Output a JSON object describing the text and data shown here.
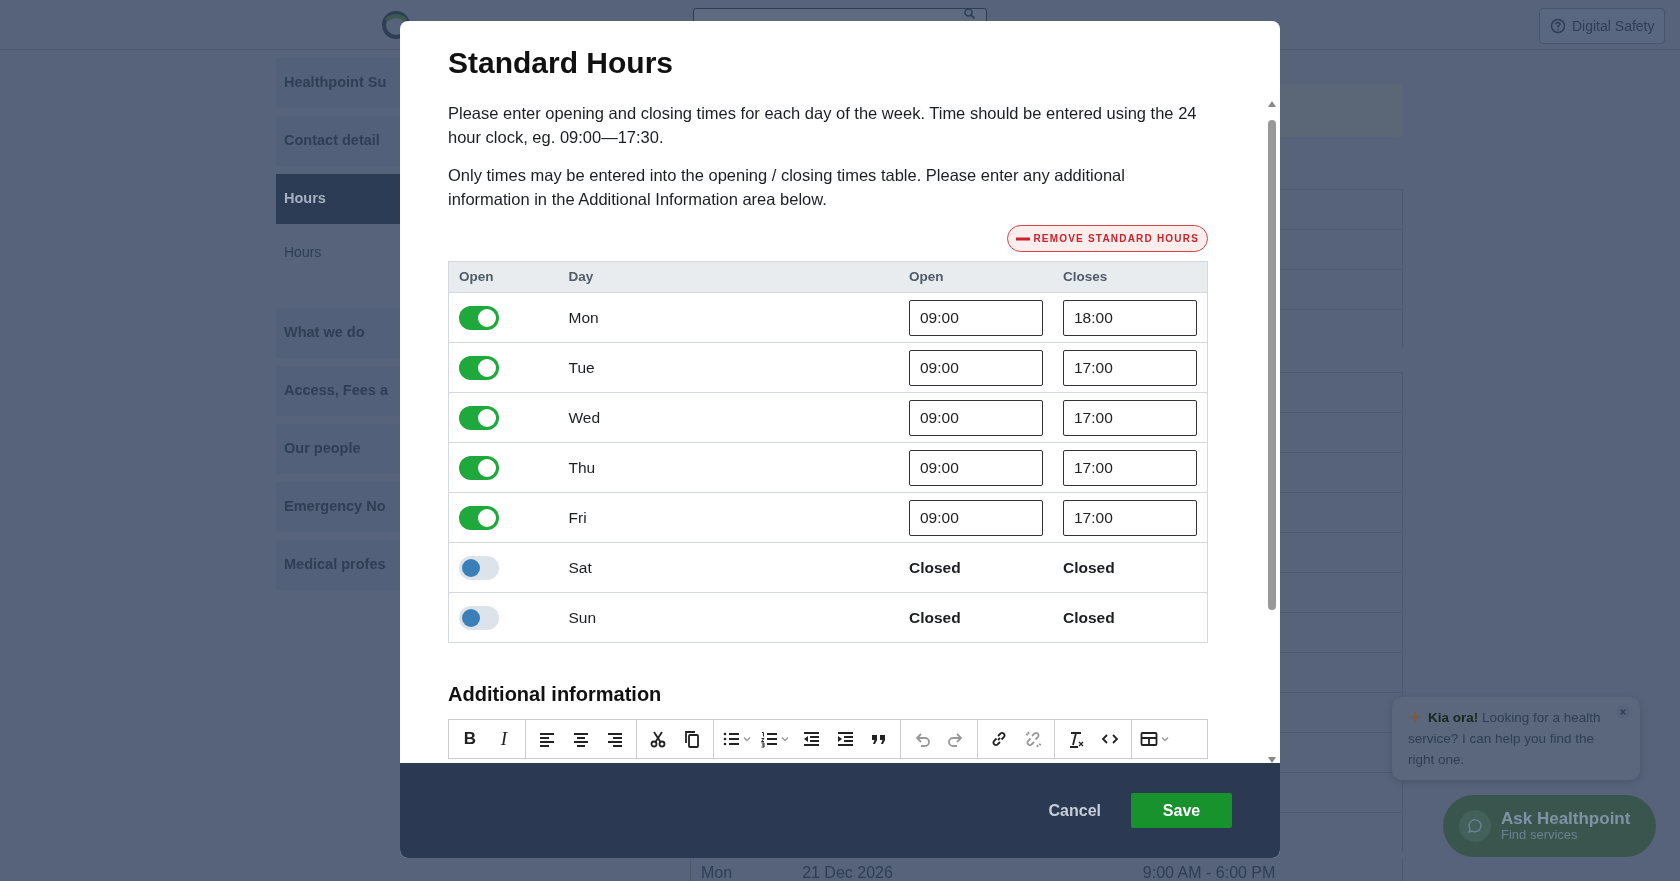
{
  "header": {
    "safety_button": "Digital Safety"
  },
  "sidebar": {
    "items": [
      {
        "label": "Healthpoint Su",
        "selected": false,
        "kind": "section"
      },
      {
        "label": "Contact detail",
        "selected": false,
        "kind": "section"
      },
      {
        "label": "Hours",
        "selected": true,
        "kind": "section"
      },
      {
        "label": "Hours",
        "selected": false,
        "kind": "sub"
      },
      {
        "label": "What we do",
        "selected": false,
        "kind": "section"
      },
      {
        "label": "Access, Fees a",
        "selected": false,
        "kind": "section"
      },
      {
        "label": "Our people",
        "selected": false,
        "kind": "section"
      },
      {
        "label": "Emergency No",
        "selected": false,
        "kind": "section"
      },
      {
        "label": "Medical profes",
        "selected": false,
        "kind": "section"
      }
    ]
  },
  "background_row": [
    "Mon",
    "21 Dec 2026",
    "9:00 AM - 6:00 PM"
  ],
  "chat": {
    "message": "**Kia ora!** Looking for a health service? I can help you find the right one.",
    "button_title": "Ask Healthpoint",
    "button_subtitle": "Find services"
  },
  "modal": {
    "title": "Standard Hours",
    "paragraphs": [
      "Please enter opening and closing times for each day of the week. Time should be entered using the 24 hour clock, eg. 09:00—17:30.",
      "Only times may be entered into the opening / closing times table. Please enter any additional information in the Additional Information area below."
    ],
    "remove_button": "REMOVE STANDARD HOURS",
    "table": {
      "columns": [
        "Open",
        "Day",
        "Open",
        "Closes"
      ],
      "rows": [
        {
          "open": true,
          "day": "Mon",
          "opens": "09:00",
          "closes": "18:00"
        },
        {
          "open": true,
          "day": "Tue",
          "opens": "09:00",
          "closes": "17:00"
        },
        {
          "open": true,
          "day": "Wed",
          "opens": "09:00",
          "closes": "17:00"
        },
        {
          "open": true,
          "day": "Thu",
          "opens": "09:00",
          "closes": "17:00"
        },
        {
          "open": true,
          "day": "Fri",
          "opens": "09:00",
          "closes": "17:00"
        },
        {
          "open": false,
          "day": "Sat",
          "opens": "Closed",
          "closes": "Closed"
        },
        {
          "open": false,
          "day": "Sun",
          "opens": "Closed",
          "closes": "Closed"
        }
      ]
    },
    "additional_heading": "Additional information",
    "toolbar": [
      [
        {
          "kind": "bold",
          "label": "B",
          "disabled": false
        },
        {
          "kind": "italic",
          "label": "I",
          "disabled": false
        }
      ],
      [
        {
          "kind": "align-left",
          "disabled": false
        },
        {
          "kind": "align-center",
          "disabled": false
        },
        {
          "kind": "align-right",
          "disabled": false
        }
      ],
      [
        {
          "kind": "cut",
          "disabled": false
        },
        {
          "kind": "copy",
          "disabled": false
        }
      ],
      [
        {
          "kind": "bullets",
          "disabled": false
        },
        {
          "kind": "numbers",
          "disabled": false
        },
        {
          "kind": "outdent",
          "disabled": false
        },
        {
          "kind": "indent",
          "disabled": false
        },
        {
          "kind": "quote",
          "disabled": false
        }
      ],
      [
        {
          "kind": "undo",
          "disabled": true
        },
        {
          "kind": "redo",
          "disabled": true
        }
      ],
      [
        {
          "kind": "link",
          "disabled": false
        },
        {
          "kind": "unlink",
          "disabled": true
        }
      ],
      [
        {
          "kind": "clear",
          "disabled": false
        },
        {
          "kind": "code",
          "disabled": false
        }
      ],
      [
        {
          "kind": "table",
          "disabled": false
        }
      ]
    ],
    "cancel_button": "Cancel",
    "save_button": "Save"
  }
}
